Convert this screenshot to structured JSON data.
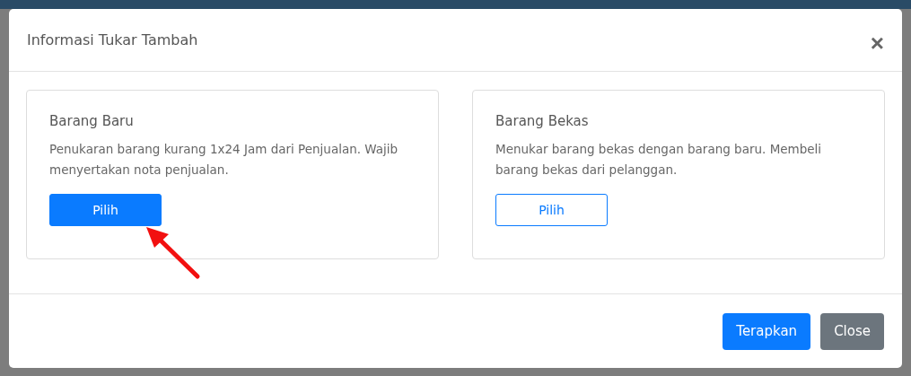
{
  "modal": {
    "title": "Informasi Tukar Tambah",
    "close_icon": "×"
  },
  "options": [
    {
      "title": "Barang Baru",
      "description": "Penukaran barang kurang 1x24 Jam dari Penjualan. Wajib menyertakan nota penjualan.",
      "button": "Pilih",
      "selected": true
    },
    {
      "title": "Barang Bekas",
      "description": "Menukar barang bekas dengan barang baru. Membeli barang bekas dari pelanggan.",
      "button": "Pilih",
      "selected": false
    }
  ],
  "footer_buttons": [
    {
      "label": "Terapkan",
      "kind": "primary"
    },
    {
      "label": "Close",
      "kind": "secondary"
    }
  ]
}
